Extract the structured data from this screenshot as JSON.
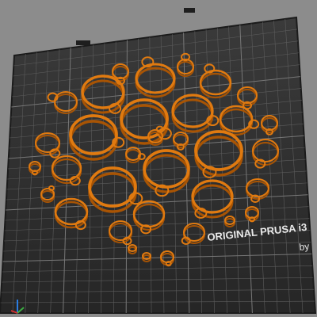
{
  "scene": {
    "background_color": "#8c8c8c",
    "bed_color": "#2f2f2f",
    "grid_color": "#6a6a6a",
    "part_color": "#e07a10",
    "bed_brand_text": "ORIGINAL PRUSA i3",
    "bed_brand_sub": "by"
  },
  "axes_icon": "axis-triad-icon",
  "parts_count": 34
}
